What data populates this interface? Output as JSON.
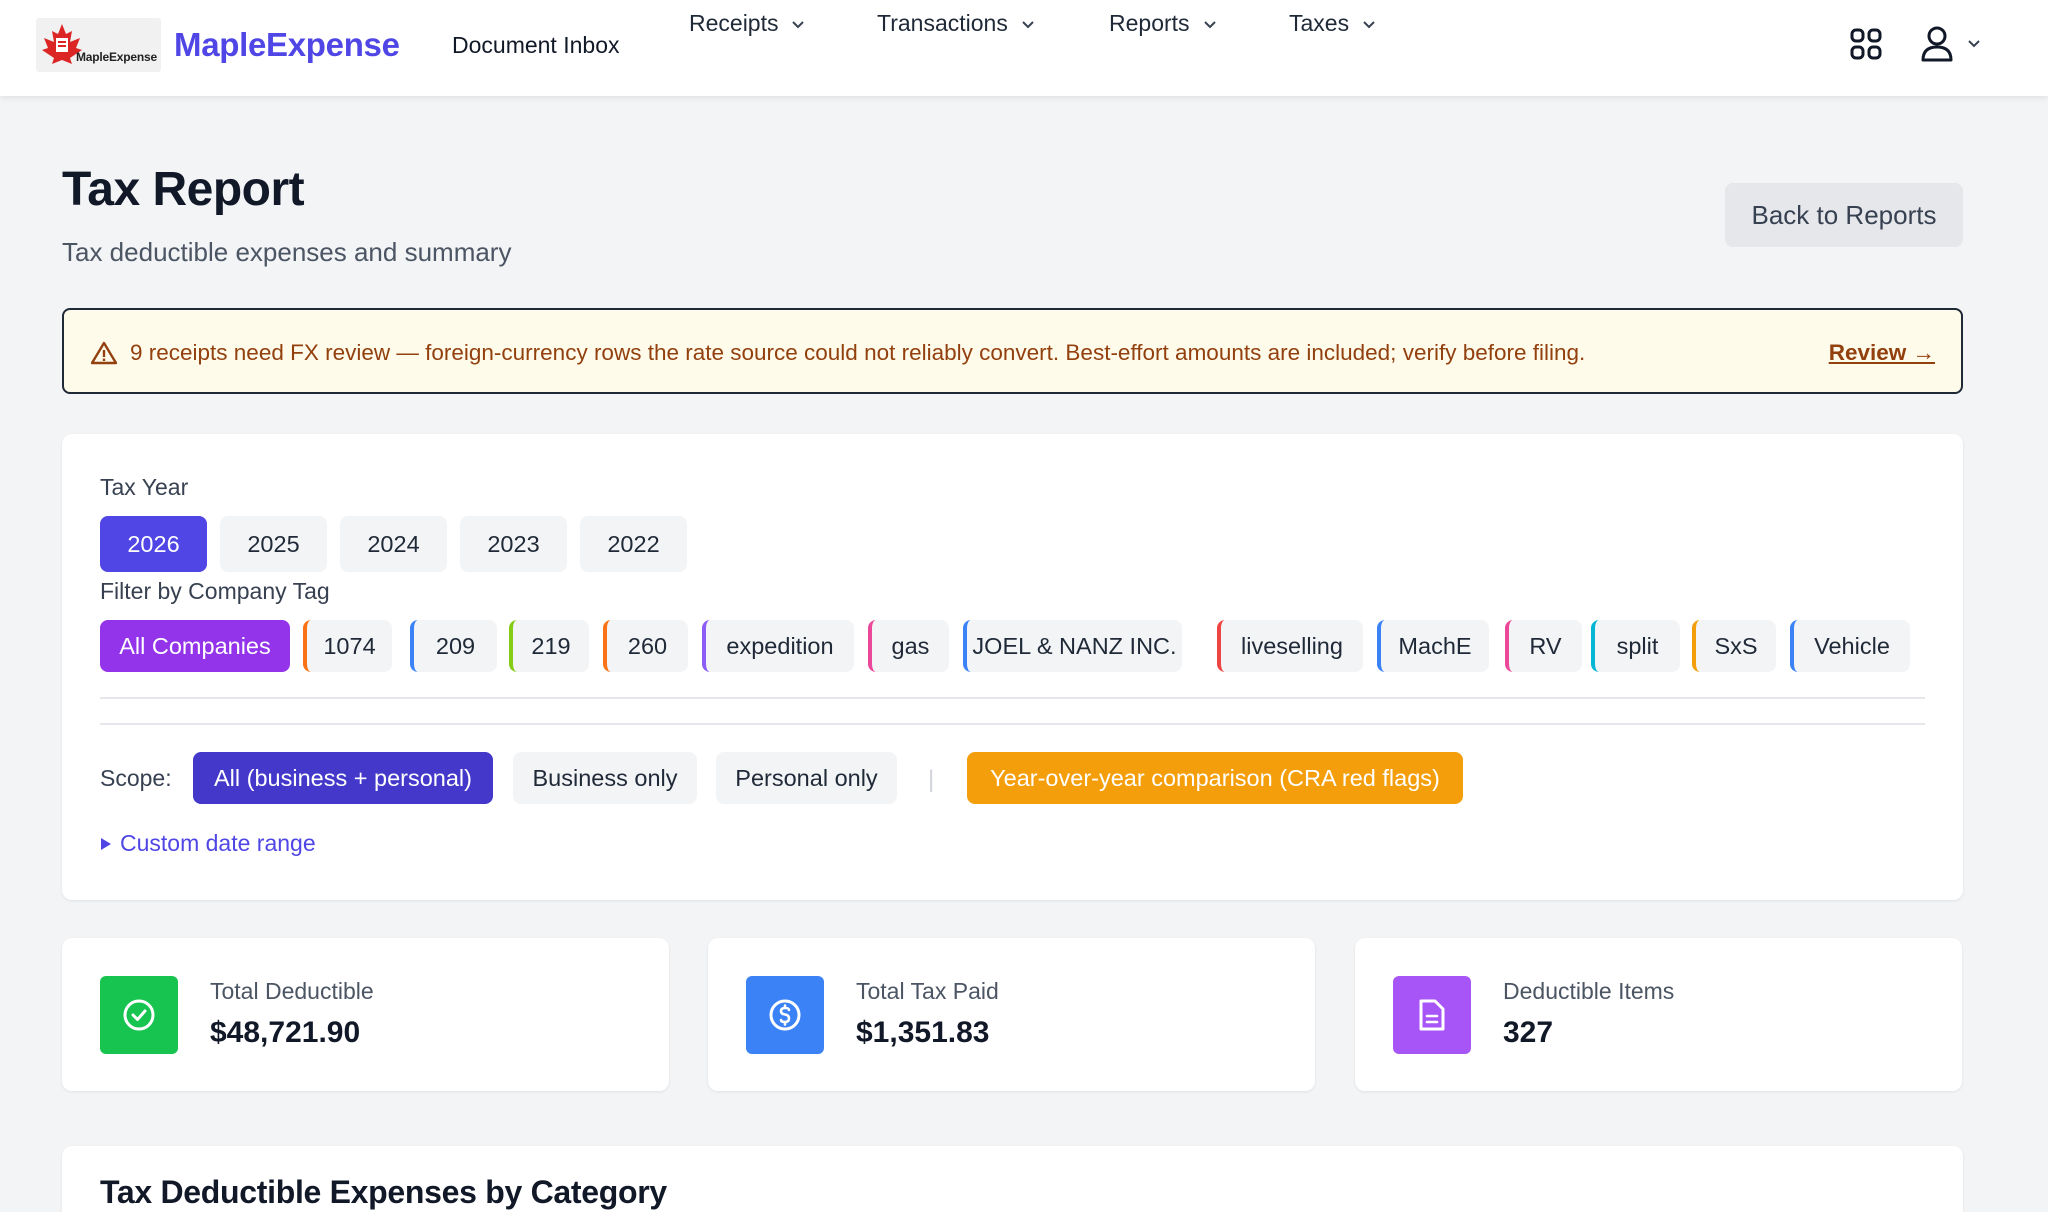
{
  "nav": {
    "logo_small_text": "MapleExpense",
    "brand": "MapleExpense",
    "inbox": "Document Inbox",
    "menus": [
      "Receipts",
      "Transactions",
      "Reports",
      "Taxes"
    ]
  },
  "header": {
    "title": "Tax Report",
    "subtitle": "Tax deductible expenses and summary",
    "back_label": "Back to Reports"
  },
  "alert": {
    "text": "9 receipts need FX review — foreign-currency rows the rate source could not reliably convert. Best-effort amounts are included; verify before filing.",
    "link": "Review →"
  },
  "filters": {
    "year_label": "Tax Year",
    "years": [
      "2026",
      "2025",
      "2024",
      "2023",
      "2022"
    ],
    "selected_year": "2026",
    "company_label": "Filter by Company Tag",
    "all_companies": "All Companies",
    "tags": [
      {
        "label": "1074",
        "color": "#f97316"
      },
      {
        "label": "209",
        "color": "#3b82f6"
      },
      {
        "label": "219",
        "color": "#84cc16"
      },
      {
        "label": "260",
        "color": "#f97316"
      },
      {
        "label": "expedition",
        "color": "#8b5cf6"
      },
      {
        "label": "gas",
        "color": "#ec4899"
      },
      {
        "label": "JOEL & NANZ INC.",
        "color": "#3b82f6"
      },
      {
        "label": "liveselling",
        "color": "#ef4444"
      },
      {
        "label": "MachE",
        "color": "#3b82f6"
      },
      {
        "label": "RV",
        "color": "#ec4899"
      },
      {
        "label": "split",
        "color": "#06b6d4"
      },
      {
        "label": "SxS",
        "color": "#f59e0b"
      },
      {
        "label": "Vehicle",
        "color": "#3b82f6"
      }
    ],
    "scope_label": "Scope:",
    "scopes": [
      "All (business + personal)",
      "Business only",
      "Personal only"
    ],
    "separator": "|",
    "yoy_label": "Year-over-year comparison (CRA red flags)",
    "custom_range": "Custom date range"
  },
  "stats": [
    {
      "label": "Total Deductible",
      "value": "$48,721.90",
      "icon": "check-circle-icon",
      "color": "#16c44f"
    },
    {
      "label": "Total Tax Paid",
      "value": "$1,351.83",
      "icon": "dollar-circle-icon",
      "color": "#3b82f6"
    },
    {
      "label": "Deductible Items",
      "value": "327",
      "icon": "document-icon",
      "color": "#a855f7"
    }
  ],
  "category_section": {
    "title": "Tax Deductible Expenses by Category"
  }
}
